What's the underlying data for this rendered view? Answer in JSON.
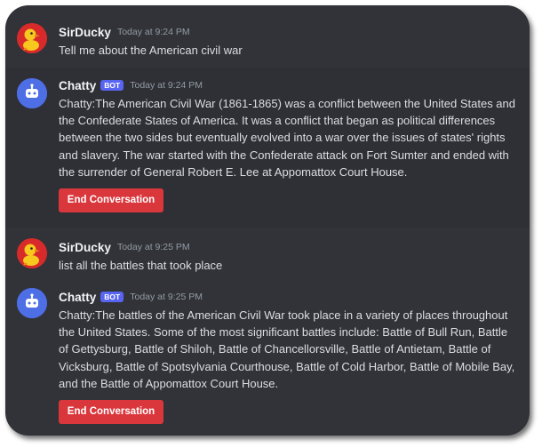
{
  "messages": [
    {
      "user": "SirDucky",
      "time": "Today at 9:24 PM",
      "text": "Tell me about the American civil war"
    },
    {
      "user": "Chatty",
      "badge": "BOT",
      "time": "Today at 9:24 PM",
      "text": "Chatty:The American Civil War (1861-1865) was a conflict between the United States and the Confederate States of America. It was a conflict that began as political differences between the two sides but eventually evolved into a war over the issues of states' rights and slavery. The war started with the Confederate attack on Fort Sumter and ended with the surrender of General Robert E. Lee at Appomattox Court House.",
      "button": "End Conversation"
    },
    {
      "user": "SirDucky",
      "time": "Today at 9:25 PM",
      "text": "list all the battles that took place"
    },
    {
      "user": "Chatty",
      "badge": "BOT",
      "time": "Today at 9:25 PM",
      "text": "Chatty:The battles of the American Civil War took place in a variety of places throughout the United States. Some of the most significant battles include: Battle of Bull Run, Battle of Gettysburg, Battle of Shiloh, Battle of Chancellorsville, Battle of Antietam, Battle of Vicksburg, Battle of Spotsylvania Courthouse, Battle of Cold Harbor, Battle of Mobile Bay, and the Battle of Appomattox Court House.",
      "button": "End Conversation"
    }
  ],
  "colors": {
    "background": "#313338",
    "username": "#f2f3f5",
    "timestamp": "#949ba4",
    "text": "#dbdee1",
    "bot_badge": "#5865f2",
    "danger_button": "#da373c",
    "bot_avatar": "#4e6ee6"
  },
  "icons": {
    "user_avatar": "duck-avatar-icon",
    "bot_avatar": "robot-avatar-icon"
  }
}
